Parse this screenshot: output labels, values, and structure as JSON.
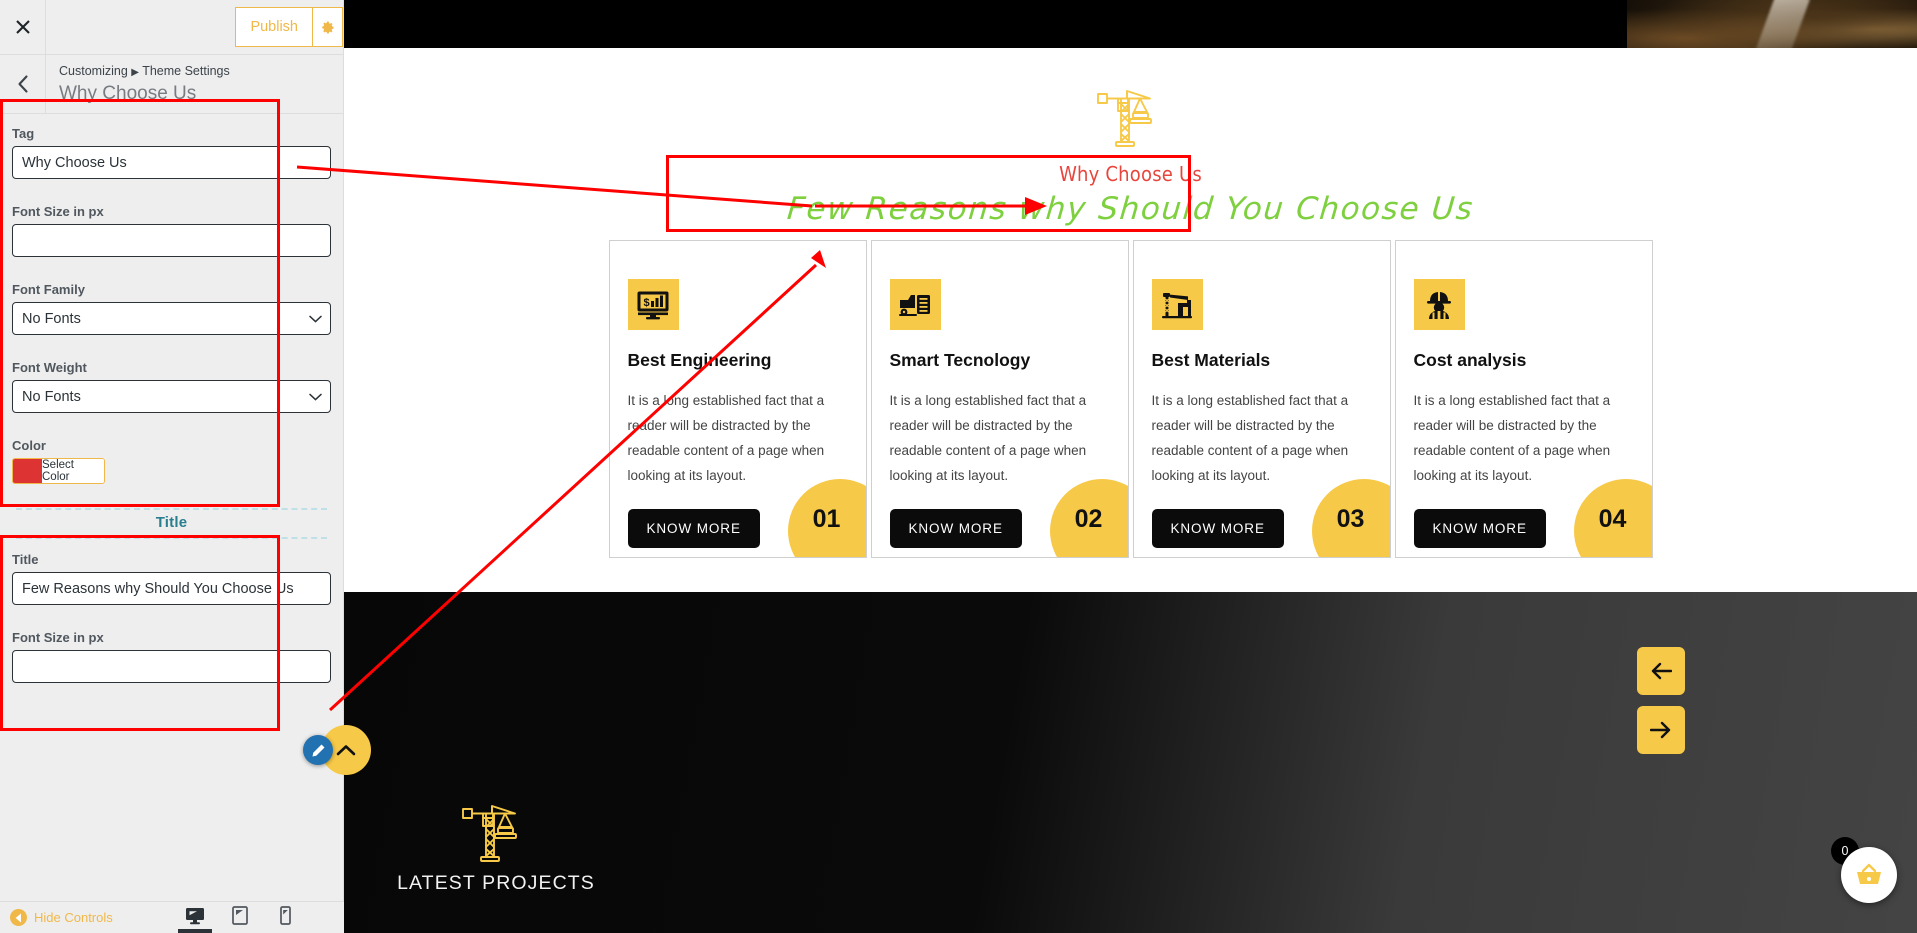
{
  "customizer": {
    "close_icon": "close-icon",
    "publish_label": "Publish",
    "gear_icon": "gear-icon",
    "back_icon": "chevron-left-icon",
    "breadcrumb_prefix": "Customizing",
    "breadcrumb_separator": "▶",
    "breadcrumb_section": "Theme Settings",
    "panel_title": "Why Choose Us",
    "tag_group": {
      "tag_label": "Tag",
      "tag_value": "Why Choose Us",
      "font_size_label": "Font Size in px",
      "font_size_value": "",
      "font_family_label": "Font Family",
      "font_family_value": "No Fonts",
      "font_weight_label": "Font Weight",
      "font_weight_value": "No Fonts",
      "color_label": "Color",
      "color_button_label": "Select Color",
      "color_swatch_hex": "#dd3333"
    },
    "title_group": {
      "section_heading": "Title",
      "title_label": "Title",
      "title_value": "Few Reasons why Should You Choose Us",
      "font_size_label": "Font Size in px",
      "font_size_value": ""
    },
    "footer": {
      "hide_controls_label": "Hide Controls",
      "hide_controls_icon": "caret-left-icon",
      "devices": [
        {
          "name": "desktop",
          "icon": "desktop-icon",
          "active": true
        },
        {
          "name": "tablet",
          "icon": "tablet-icon",
          "active": false
        },
        {
          "name": "mobile",
          "icon": "mobile-icon",
          "active": false
        }
      ]
    }
  },
  "preview": {
    "section": {
      "crane_icon": "crane-icon",
      "tag": "Why Choose Us",
      "tag_color": "#e8453c",
      "title": "Few Reasons why Should You Choose Us",
      "title_color": "#7ed03f"
    },
    "cards": [
      {
        "icon": "monitor-chart-icon",
        "title": "Best Engineering",
        "text": "It is a long established fact that a reader will be distracted by the readable content of a page when looking at its layout.",
        "button_label": "KNOW MORE",
        "number": "01"
      },
      {
        "icon": "dump-truck-icon",
        "title": "Smart Tecnology",
        "text": "It is a long established fact that a reader will be distracted by the readable content of a page when looking at its layout.",
        "button_label": "KNOW MORE",
        "number": "02"
      },
      {
        "icon": "construction-site-icon",
        "title": "Best Materials",
        "text": "It is a long established fact that a reader will be distracted by the readable content of a page when looking at its layout.",
        "button_label": "KNOW MORE",
        "number": "03"
      },
      {
        "icon": "worker-helmet-icon",
        "title": "Cost analysis",
        "text": "It is a long established fact that a reader will be distracted by the readable content of a page when looking at its layout.",
        "button_label": "KNOW MORE",
        "number": "04"
      }
    ],
    "footer": {
      "crane_icon": "crane-icon",
      "label": "LATEST PROJECTS",
      "prev_icon": "arrow-left-icon",
      "next_icon": "arrow-right-icon",
      "cart_icon": "shopping-basket-icon",
      "cart_count": "0",
      "edit_icon": "pencil-icon",
      "scroll_top_icon": "chevron-up-icon"
    }
  },
  "accents": {
    "wp_yellow": "#f0b849",
    "theme_yellow": "#f7c948",
    "annotation_red": "#ff0000",
    "dark": "#0b0b0b"
  }
}
